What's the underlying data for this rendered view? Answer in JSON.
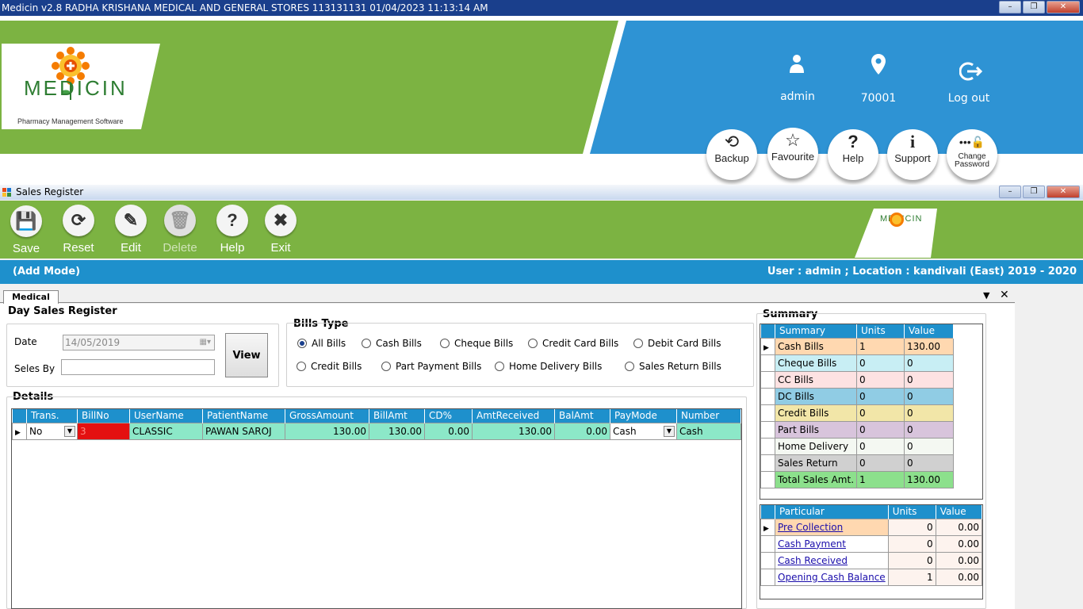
{
  "window": {
    "title": "Medicin v2.8  RADHA KRISHANA MEDICAL AND GENERAL STORES  113131131  01/04/2023 11:13:14 AM"
  },
  "header": {
    "logo_text": "MEDICIN",
    "logo_sub": "Pharmacy Management Software",
    "user": "admin",
    "location": "70001",
    "logout": "Log out",
    "buttons": [
      {
        "label": "Backup",
        "icon": "history-icon"
      },
      {
        "label": "Favourite",
        "icon": "star-icon"
      },
      {
        "label": "Help",
        "icon": "question-icon"
      },
      {
        "label": "Support",
        "icon": "info-icon"
      },
      {
        "label": "Change Password",
        "icon": "password-icon"
      }
    ]
  },
  "sales_window": {
    "title": "Sales Register"
  },
  "toolbar": {
    "save": "Save",
    "reset": "Reset",
    "edit": "Edit",
    "delete": "Delete",
    "help": "Help",
    "exit": "Exit"
  },
  "mode_bar": {
    "mode": "(Add Mode)",
    "user_info": "User : admin ; Location : kandivali (East)   2019 - 2020"
  },
  "tab": "Medical",
  "day_sales": {
    "title": "Day Sales Register",
    "date_label": "Date",
    "date_value": "14/05/2019",
    "seles_by_label": "Seles By",
    "view_button": "View"
  },
  "bills_type": {
    "title": "Bills  Type",
    "options": [
      "All Bills",
      "Cash Bills",
      "Cheque Bills",
      "Credit Card Bills",
      "Debit Card Bills",
      "Credit Bills",
      "Part Payment Bills",
      "Home Delivery Bills",
      "Sales Return Bills"
    ],
    "selected": "All Bills"
  },
  "details": {
    "title": "Details",
    "columns": [
      "Trans.",
      "BillNo",
      "UserName",
      "PatientName",
      "GrossAmount",
      "BillAmt",
      "CD%",
      "AmtReceived",
      "BalAmt",
      "PayMode",
      "Number"
    ],
    "rows": [
      {
        "trans": "No",
        "billno": "3",
        "username": "CLASSIC",
        "patient": "PAWAN SAROJ",
        "gross": "130.00",
        "billamt": "130.00",
        "cd": "0.00",
        "received": "130.00",
        "bal": "0.00",
        "paymode": "Cash",
        "number": "Cash"
      }
    ]
  },
  "summary": {
    "title": "Summary",
    "columns": [
      "Summary",
      "Units",
      "Value"
    ],
    "rows": [
      {
        "name": "Cash Bills",
        "units": "1",
        "value": "130.00",
        "color": "#ffd8b0"
      },
      {
        "name": "Cheque Bills",
        "units": "0",
        "value": "0",
        "color": "#c8eef4"
      },
      {
        "name": "CC Bills",
        "units": "0",
        "value": "0",
        "color": "#fde2e2"
      },
      {
        "name": "DC Bills",
        "units": "0",
        "value": "0",
        "color": "#90cce4"
      },
      {
        "name": "Credit Bills",
        "units": "0",
        "value": "0",
        "color": "#f2e6a8"
      },
      {
        "name": "Part Bills",
        "units": "0",
        "value": "0",
        "color": "#d8c4dc"
      },
      {
        "name": "Home Delivery",
        "units": "0",
        "value": "0",
        "color": "#f4f8f2"
      },
      {
        "name": "Sales Return",
        "units": "0",
        "value": "0",
        "color": "#d0d0d0"
      },
      {
        "name": "Total Sales Amt.",
        "units": "1",
        "value": "130.00",
        "color": "#8ce08c"
      }
    ]
  },
  "particular": {
    "columns": [
      "Particular",
      "Units",
      "Value"
    ],
    "rows": [
      {
        "name": "Pre Collection",
        "units": "0",
        "value": "0.00"
      },
      {
        "name": "Cash Payment",
        "units": "0",
        "value": "0.00"
      },
      {
        "name": "Cash Received",
        "units": "0",
        "value": "0.00"
      },
      {
        "name": "Opening Cash Balance",
        "units": "1",
        "value": "0.00"
      }
    ]
  }
}
